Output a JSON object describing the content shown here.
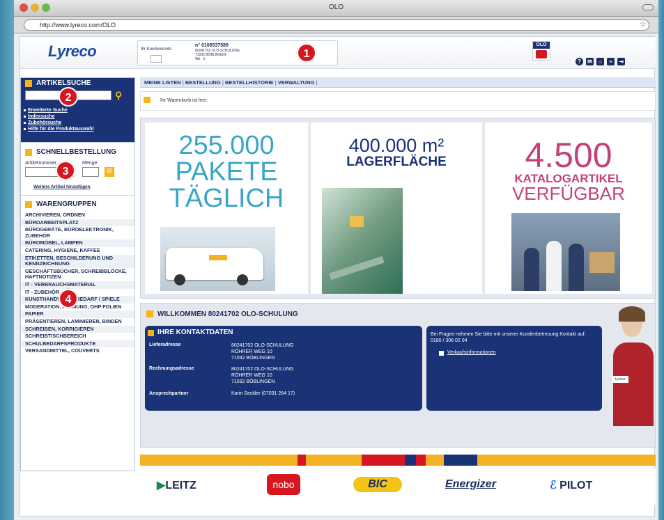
{
  "window": {
    "title": "OLO",
    "url": "http://www.lyreco.com/OLO"
  },
  "header": {
    "logo": "Lyreco",
    "account": {
      "label": "Ihr Kundenkonto",
      "number": "n° 0106537589",
      "lines": [
        "80241702 OLO-SCHULUNG",
        "71032 BÖBLINGEN",
        "Wk - 1 -"
      ]
    },
    "olo_logo": "OLO"
  },
  "badges": [
    "1",
    "2",
    "3",
    "4"
  ],
  "sidebar": {
    "search": {
      "title": "ARTIKELSUCHE",
      "links": [
        "Erweiterte Suche",
        "Indexsuche",
        "Zubehörsuche",
        "Hilfe für die Produktauswahl"
      ]
    },
    "quick": {
      "title": "SCHNELLBESTELLUNG",
      "field_label": "Artikelnummer",
      "qty_label": "Menge",
      "add_link": "Weitere Artikel hinzufügen"
    },
    "groups": {
      "title": "WARENGRUPPEN",
      "items": [
        "ARCHIVIEREN, ORDNEN",
        "BÜROARBEITSPLATZ",
        "BÜROGERÄTE, BÜROELEKTRONIK, ZUBEHÖR",
        "BÜROMÖBEL, LAMPEN",
        "CATERING, HYGIENE, KAFFEE",
        "ETIKETTEN, BESCHILDERUNG UND KENNZEICHNUNG",
        "GESCHÄFTSBÜCHER, SCHREIBBLÖCKE, HAFTNOTIZEN",
        "IT - VERBRAUCHSMATERIAL",
        "IT - ZUBEHÖR",
        "KUNSTHANDWERKSBEDARF / SPIELE",
        "MODERATION, PLANUNG, OHP FOLIEN",
        "PAPIER",
        "PRÄSENTIEREN, LAMINIEREN, BINDEN",
        "SCHREIBEN, KORRIGIEREN",
        "SCHREIBTISCHBEREICH",
        "SCHULBEDARFSPRODUKTE",
        "VERSANDMITTEL, COUVERTS"
      ]
    }
  },
  "nav": {
    "items": [
      "MEINE LISTEN",
      "BESTELLUNG",
      "BESTELLHISTORIE",
      "VERWALTUNG"
    ]
  },
  "cart": {
    "text": "Ihr Warenkorb ist leer."
  },
  "banner": {
    "p1": {
      "num": "255.000",
      "l1": "PAKETE",
      "l2": "TÄGLICH"
    },
    "p2": {
      "num": "400.000 m²",
      "l1": "LAGERFLÄCHE"
    },
    "p3": {
      "num": "4.500",
      "l1": "KATALOGARTIKEL",
      "l2": "VERFÜGBAR"
    }
  },
  "welcome": {
    "title": "WILLKOMMEN 80241702 OLO-SCHULUNG",
    "contact_title": "IHRE KONTAKTDATEN",
    "rows": [
      {
        "label": "Lieferadresse",
        "value": [
          "80241702 OLO-SCHULUNG",
          "RÖHRER WEG 10",
          "71032 BÖBLINGEN"
        ]
      },
      {
        "label": "Rechnungsadresse",
        "value": [
          "80241702 OLO-SCHULUNG",
          "RÖHRER WEG 10",
          "71032 BÖBLINGEN"
        ]
      },
      {
        "label": "Ansprechpartner",
        "value": [
          "Karin Seckler (07031 264 17)"
        ]
      }
    ],
    "help": "Bei Fragen nehmen Sie bitte mit unserer Kundenbetreuung Kontakt auf: 0180 / 306 02 04",
    "help_link": "Verkaufsinformationen",
    "name_tag": "Lyreco"
  },
  "brands": [
    "LEITZ",
    "nobo",
    "BIC",
    "Energizer",
    "PILOT"
  ],
  "colors": {
    "navy": "#1a3377",
    "yellow": "#f3b223",
    "cyan": "#3aa5c8",
    "magenta": "#c2437a",
    "red": "#d6171f"
  }
}
